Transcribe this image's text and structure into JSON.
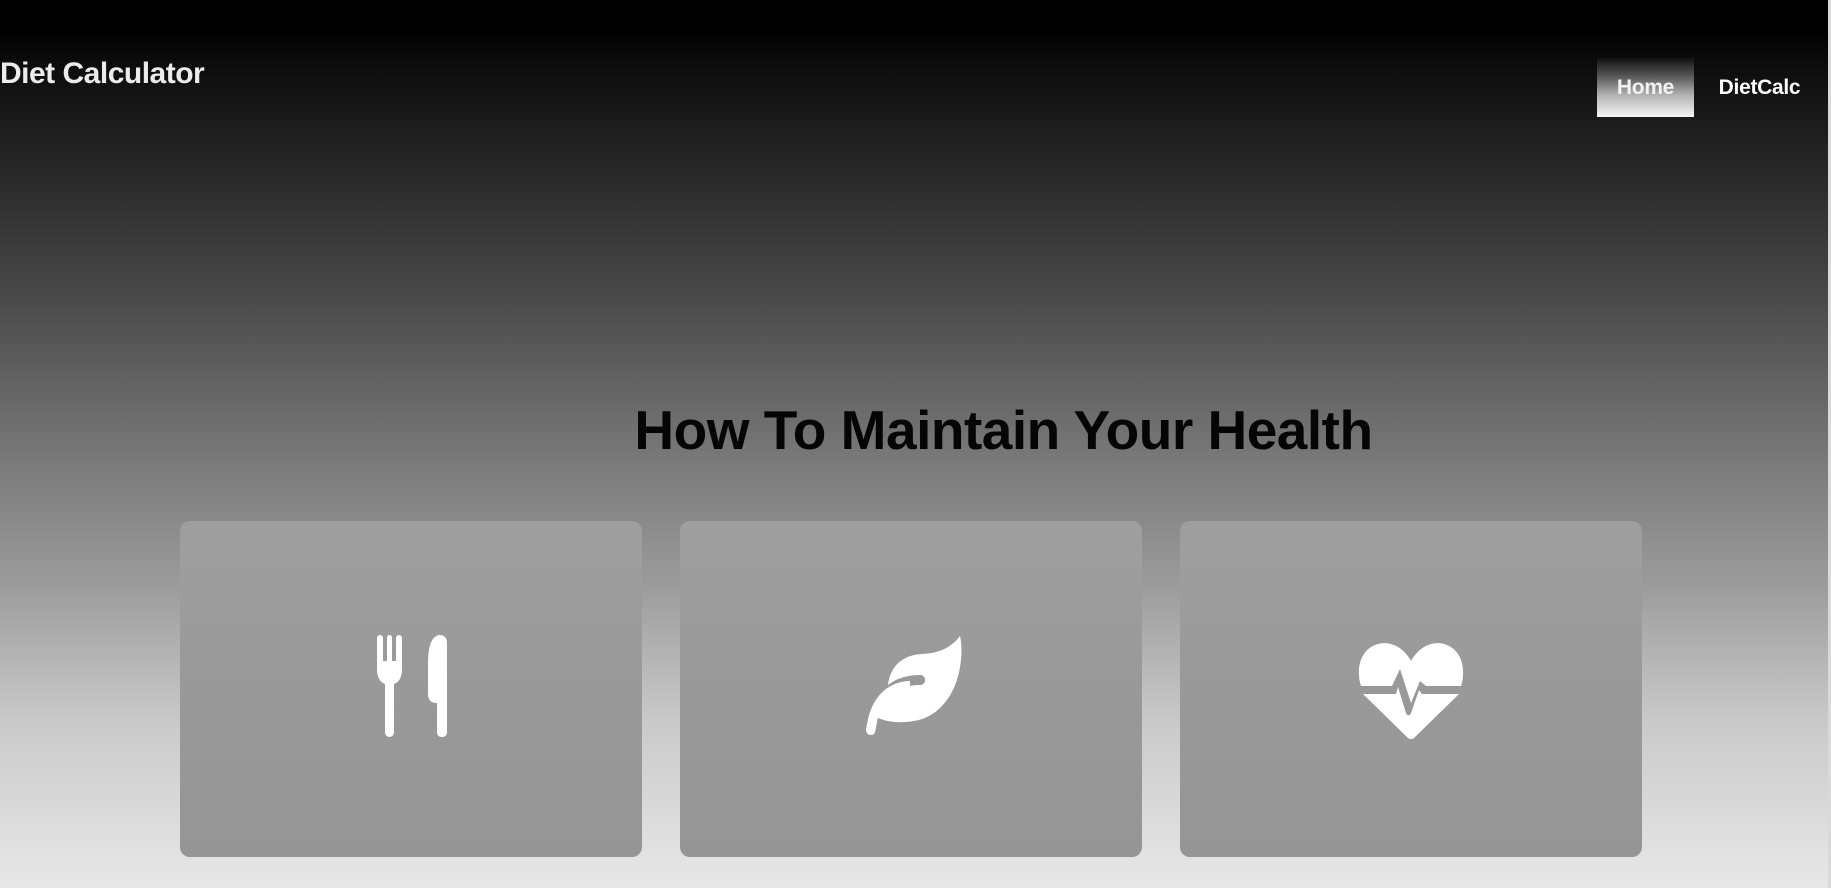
{
  "header": {
    "brand": "Diet Calculator",
    "nav": [
      {
        "label": "Home",
        "active": true
      },
      {
        "label": "DietCalc",
        "active": false
      }
    ]
  },
  "main": {
    "heading": "How To Maintain Your Health",
    "cards": [
      {
        "icon": "utensils-icon"
      },
      {
        "icon": "leaf-icon"
      },
      {
        "icon": "heart-pulse-icon"
      }
    ]
  },
  "colors": {
    "text_light": "#ffffff",
    "heading": "#050505",
    "card_background": "#999999"
  }
}
